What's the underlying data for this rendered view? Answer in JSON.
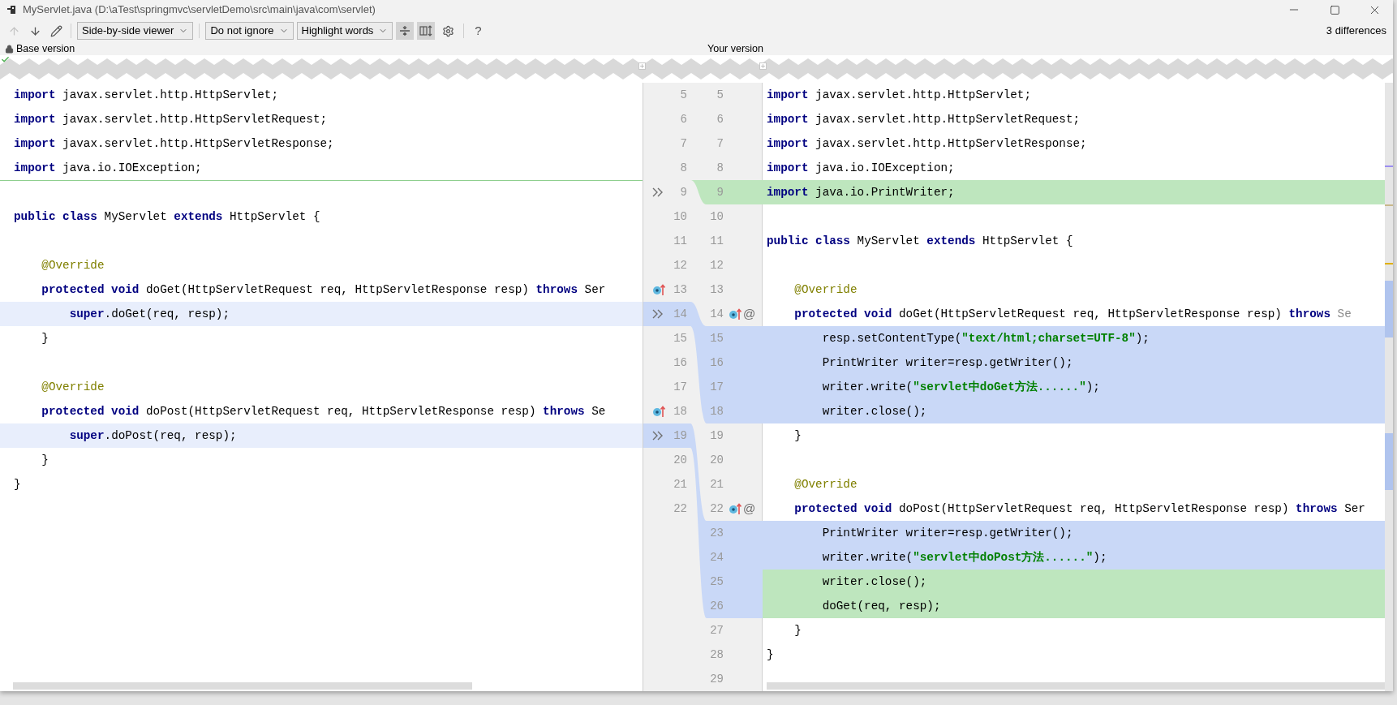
{
  "window": {
    "title": "MyServlet.java (D:\\aTest\\springmvc\\servletDemo\\src\\main\\java\\com\\servlet)"
  },
  "toolbar": {
    "nav": [
      {
        "kind": "up",
        "disabled": true
      },
      {
        "kind": "down",
        "disabled": false
      },
      {
        "kind": "edit",
        "disabled": false
      }
    ],
    "dropdowns": [
      {
        "label": "Side-by-side viewer"
      },
      {
        "label": "Do not ignore"
      },
      {
        "label": "Highlight words"
      }
    ],
    "toggles": [
      {
        "kind": "collapse",
        "selected": true
      },
      {
        "kind": "sync-scroll",
        "selected": true
      }
    ],
    "help": "?",
    "differences": "3 differences"
  },
  "left_pane": {
    "title": "Base version",
    "locked": true,
    "status_ok": true
  },
  "right_pane": {
    "title": "Your version"
  },
  "left_lines": [
    {
      "number": "5",
      "code": [
        {
          "kind": "keyword",
          "text": "import"
        },
        {
          "kind": "plain",
          "text": " javax.servlet.http.HttpServlet;"
        }
      ],
      "modified": false,
      "insertion_mark": false,
      "arrow": false,
      "overrides": false
    },
    {
      "number": "6",
      "code": [
        {
          "kind": "keyword",
          "text": "import"
        },
        {
          "kind": "plain",
          "text": " javax.servlet.http.HttpServletRequest;"
        }
      ],
      "modified": false,
      "insertion_mark": false,
      "arrow": false,
      "overrides": false
    },
    {
      "number": "7",
      "code": [
        {
          "kind": "keyword",
          "text": "import"
        },
        {
          "kind": "plain",
          "text": " javax.servlet.http.HttpServletResponse;"
        }
      ],
      "modified": false,
      "insertion_mark": false,
      "arrow": false,
      "overrides": false
    },
    {
      "number": "8",
      "code": [
        {
          "kind": "keyword",
          "text": "import"
        },
        {
          "kind": "plain",
          "text": " java.io.IOException;"
        }
      ],
      "modified": false,
      "insertion_mark": false,
      "arrow": false,
      "overrides": false
    },
    {
      "number": "9",
      "modified": false,
      "insertion_mark": true,
      "arrow": true,
      "overrides": false
    },
    {
      "number": "10",
      "code": [
        {
          "kind": "keyword",
          "text": "public class"
        },
        {
          "kind": "plain",
          "text": " MyServlet "
        },
        {
          "kind": "keyword",
          "text": "extends"
        },
        {
          "kind": "plain",
          "text": " HttpServlet {"
        }
      ],
      "modified": false,
      "insertion_mark": false,
      "arrow": false,
      "overrides": false
    },
    {
      "number": "11",
      "modified": false,
      "insertion_mark": false,
      "arrow": false,
      "overrides": false
    },
    {
      "number": "12",
      "code": [
        {
          "kind": "annotation",
          "text": "    @Override"
        }
      ],
      "modified": false,
      "insertion_mark": false,
      "arrow": false,
      "overrides": false
    },
    {
      "number": "13",
      "code": [
        {
          "kind": "keyword",
          "text": "    protected void"
        },
        {
          "kind": "plain",
          "text": " doGet(HttpServletRequest req, HttpServletResponse resp) "
        },
        {
          "kind": "keyword",
          "text": "throws"
        },
        {
          "kind": "plain",
          "text": " Ser"
        }
      ],
      "modified": false,
      "insertion_mark": false,
      "arrow": false,
      "overrides": true
    },
    {
      "number": "14",
      "code": [
        {
          "kind": "keyword",
          "text": "        super"
        },
        {
          "kind": "plain",
          "text": ".doGet(req, resp);"
        }
      ],
      "modified": true,
      "insertion_mark": false,
      "arrow": true,
      "overrides": false
    },
    {
      "number": "15",
      "code": [
        {
          "kind": "plain",
          "text": "    }"
        }
      ],
      "modified": false,
      "insertion_mark": false,
      "arrow": false,
      "overrides": false
    },
    {
      "number": "16",
      "modified": false,
      "insertion_mark": false,
      "arrow": false,
      "overrides": false
    },
    {
      "number": "17",
      "code": [
        {
          "kind": "annotation",
          "text": "    @Override"
        }
      ],
      "modified": false,
      "insertion_mark": false,
      "arrow": false,
      "overrides": false
    },
    {
      "number": "18",
      "code": [
        {
          "kind": "keyword",
          "text": "    protected void"
        },
        {
          "kind": "plain",
          "text": " doPost(HttpServletRequest req, HttpServletResponse resp) "
        },
        {
          "kind": "keyword",
          "text": "throws"
        },
        {
          "kind": "plain",
          "text": " Se"
        }
      ],
      "modified": false,
      "insertion_mark": false,
      "arrow": false,
      "overrides": true
    },
    {
      "number": "19",
      "code": [
        {
          "kind": "keyword",
          "text": "        super"
        },
        {
          "kind": "plain",
          "text": ".doPost(req, resp);"
        }
      ],
      "modified": true,
      "insertion_mark": false,
      "arrow": true,
      "overrides": false
    },
    {
      "number": "20",
      "code": [
        {
          "kind": "plain",
          "text": "    }"
        }
      ],
      "modified": false,
      "insertion_mark": false,
      "arrow": false,
      "overrides": false
    },
    {
      "number": "21",
      "code": [
        {
          "kind": "plain",
          "text": "}"
        }
      ],
      "modified": false,
      "insertion_mark": false,
      "arrow": false,
      "overrides": false
    },
    {
      "number": "22",
      "modified": false,
      "insertion_mark": false,
      "arrow": false,
      "overrides": false
    }
  ],
  "right_lines": [
    {
      "number": "5",
      "code": [
        {
          "kind": "keyword",
          "text": "import"
        },
        {
          "kind": "plain",
          "text": " javax.servlet.http.HttpServlet;"
        }
      ],
      "modified": false,
      "inserted": false,
      "overrides": false
    },
    {
      "number": "6",
      "code": [
        {
          "kind": "keyword",
          "text": "import"
        },
        {
          "kind": "plain",
          "text": " javax.servlet.http.HttpServletRequest;"
        }
      ],
      "modified": false,
      "inserted": false,
      "overrides": false
    },
    {
      "number": "7",
      "code": [
        {
          "kind": "keyword",
          "text": "import"
        },
        {
          "kind": "plain",
          "text": " javax.servlet.http.HttpServletResponse;"
        }
      ],
      "modified": false,
      "inserted": false,
      "overrides": false
    },
    {
      "number": "8",
      "code": [
        {
          "kind": "keyword",
          "text": "import"
        },
        {
          "kind": "plain",
          "text": " java.io.IOException;"
        }
      ],
      "modified": false,
      "inserted": false,
      "overrides": false
    },
    {
      "number": "9",
      "code": [
        {
          "kind": "keyword",
          "text": "import"
        },
        {
          "kind": "plain",
          "text": " java.io.PrintWriter;"
        }
      ],
      "modified": false,
      "inserted": true,
      "overrides": false
    },
    {
      "number": "10",
      "modified": false,
      "inserted": false,
      "overrides": false
    },
    {
      "number": "11",
      "code": [
        {
          "kind": "keyword",
          "text": "public class"
        },
        {
          "kind": "plain",
          "text": " MyServlet "
        },
        {
          "kind": "keyword",
          "text": "extends"
        },
        {
          "kind": "plain",
          "text": " HttpServlet {"
        }
      ],
      "modified": false,
      "inserted": false,
      "overrides": false
    },
    {
      "number": "12",
      "modified": false,
      "inserted": false,
      "overrides": false
    },
    {
      "number": "13",
      "code": [
        {
          "kind": "annotation",
          "text": "    @Override"
        }
      ],
      "modified": false,
      "inserted": false,
      "overrides": false
    },
    {
      "number": "14",
      "code": [
        {
          "kind": "keyword",
          "text": "    protected void"
        },
        {
          "kind": "plain",
          "text": " doGet(HttpServletRequest req, HttpServletResponse resp) "
        },
        {
          "kind": "keyword",
          "text": "throws"
        },
        {
          "kind": "dim",
          "text": " Se"
        }
      ],
      "modified": false,
      "inserted": false,
      "overrides": true,
      "mark": "@"
    },
    {
      "number": "15",
      "code": [
        {
          "kind": "plain",
          "text": "        resp.setContentType("
        },
        {
          "kind": "string",
          "text": "\"text/html;charset=UTF-8\""
        },
        {
          "kind": "plain",
          "text": ");"
        }
      ],
      "modified": true,
      "inserted": false,
      "overrides": false
    },
    {
      "number": "16",
      "code": [
        {
          "kind": "plain",
          "text": "        PrintWriter writer=resp.getWriter();"
        }
      ],
      "modified": true,
      "inserted": false,
      "overrides": false
    },
    {
      "number": "17",
      "code": [
        {
          "kind": "plain",
          "text": "        writer.write("
        },
        {
          "kind": "string",
          "text": "\"servlet中doGet方法......\""
        },
        {
          "kind": "plain",
          "text": ");"
        }
      ],
      "modified": true,
      "inserted": false,
      "overrides": false
    },
    {
      "number": "18",
      "code": [
        {
          "kind": "plain",
          "text": "        writer.close();"
        }
      ],
      "modified": true,
      "inserted": false,
      "overrides": false
    },
    {
      "number": "19",
      "code": [
        {
          "kind": "plain",
          "text": "    }"
        }
      ],
      "modified": false,
      "inserted": false,
      "overrides": false
    },
    {
      "number": "20",
      "modified": false,
      "inserted": false,
      "overrides": false
    },
    {
      "number": "21",
      "code": [
        {
          "kind": "annotation",
          "text": "    @Override"
        }
      ],
      "modified": false,
      "inserted": false,
      "overrides": false
    },
    {
      "number": "22",
      "code": [
        {
          "kind": "keyword",
          "text": "    protected void"
        },
        {
          "kind": "plain",
          "text": " doPost(HttpServletRequest req, HttpServletResponse resp) "
        },
        {
          "kind": "keyword",
          "text": "throws"
        },
        {
          "kind": "plain",
          "text": " Ser"
        }
      ],
      "modified": false,
      "inserted": false,
      "overrides": true,
      "mark": "@"
    },
    {
      "number": "23",
      "code": [
        {
          "kind": "plain",
          "text": "        PrintWriter writer=resp.getWriter();"
        }
      ],
      "modified": true,
      "inserted": false,
      "overrides": false
    },
    {
      "number": "24",
      "code": [
        {
          "kind": "plain",
          "text": "        writer.write("
        },
        {
          "kind": "string",
          "text": "\"servlet中doPost方法......\""
        },
        {
          "kind": "plain",
          "text": ");"
        }
      ],
      "modified": true,
      "inserted": false,
      "overrides": false
    },
    {
      "number": "25",
      "code": [
        {
          "kind": "plain",
          "text": "        writer.close();"
        }
      ],
      "modified": false,
      "inserted": true,
      "overrides": false
    },
    {
      "number": "26",
      "code": [
        {
          "kind": "plain",
          "text": "        doGet(req, resp);"
        }
      ],
      "modified": false,
      "inserted": true,
      "overrides": false
    },
    {
      "number": "27",
      "code": [
        {
          "kind": "plain",
          "text": "    }"
        }
      ],
      "modified": false,
      "inserted": false,
      "overrides": false
    },
    {
      "number": "28",
      "code": [
        {
          "kind": "plain",
          "text": "}"
        }
      ],
      "modified": false,
      "inserted": false,
      "overrides": false
    },
    {
      "number": "29",
      "modified": false,
      "inserted": false,
      "overrides": false
    }
  ]
}
